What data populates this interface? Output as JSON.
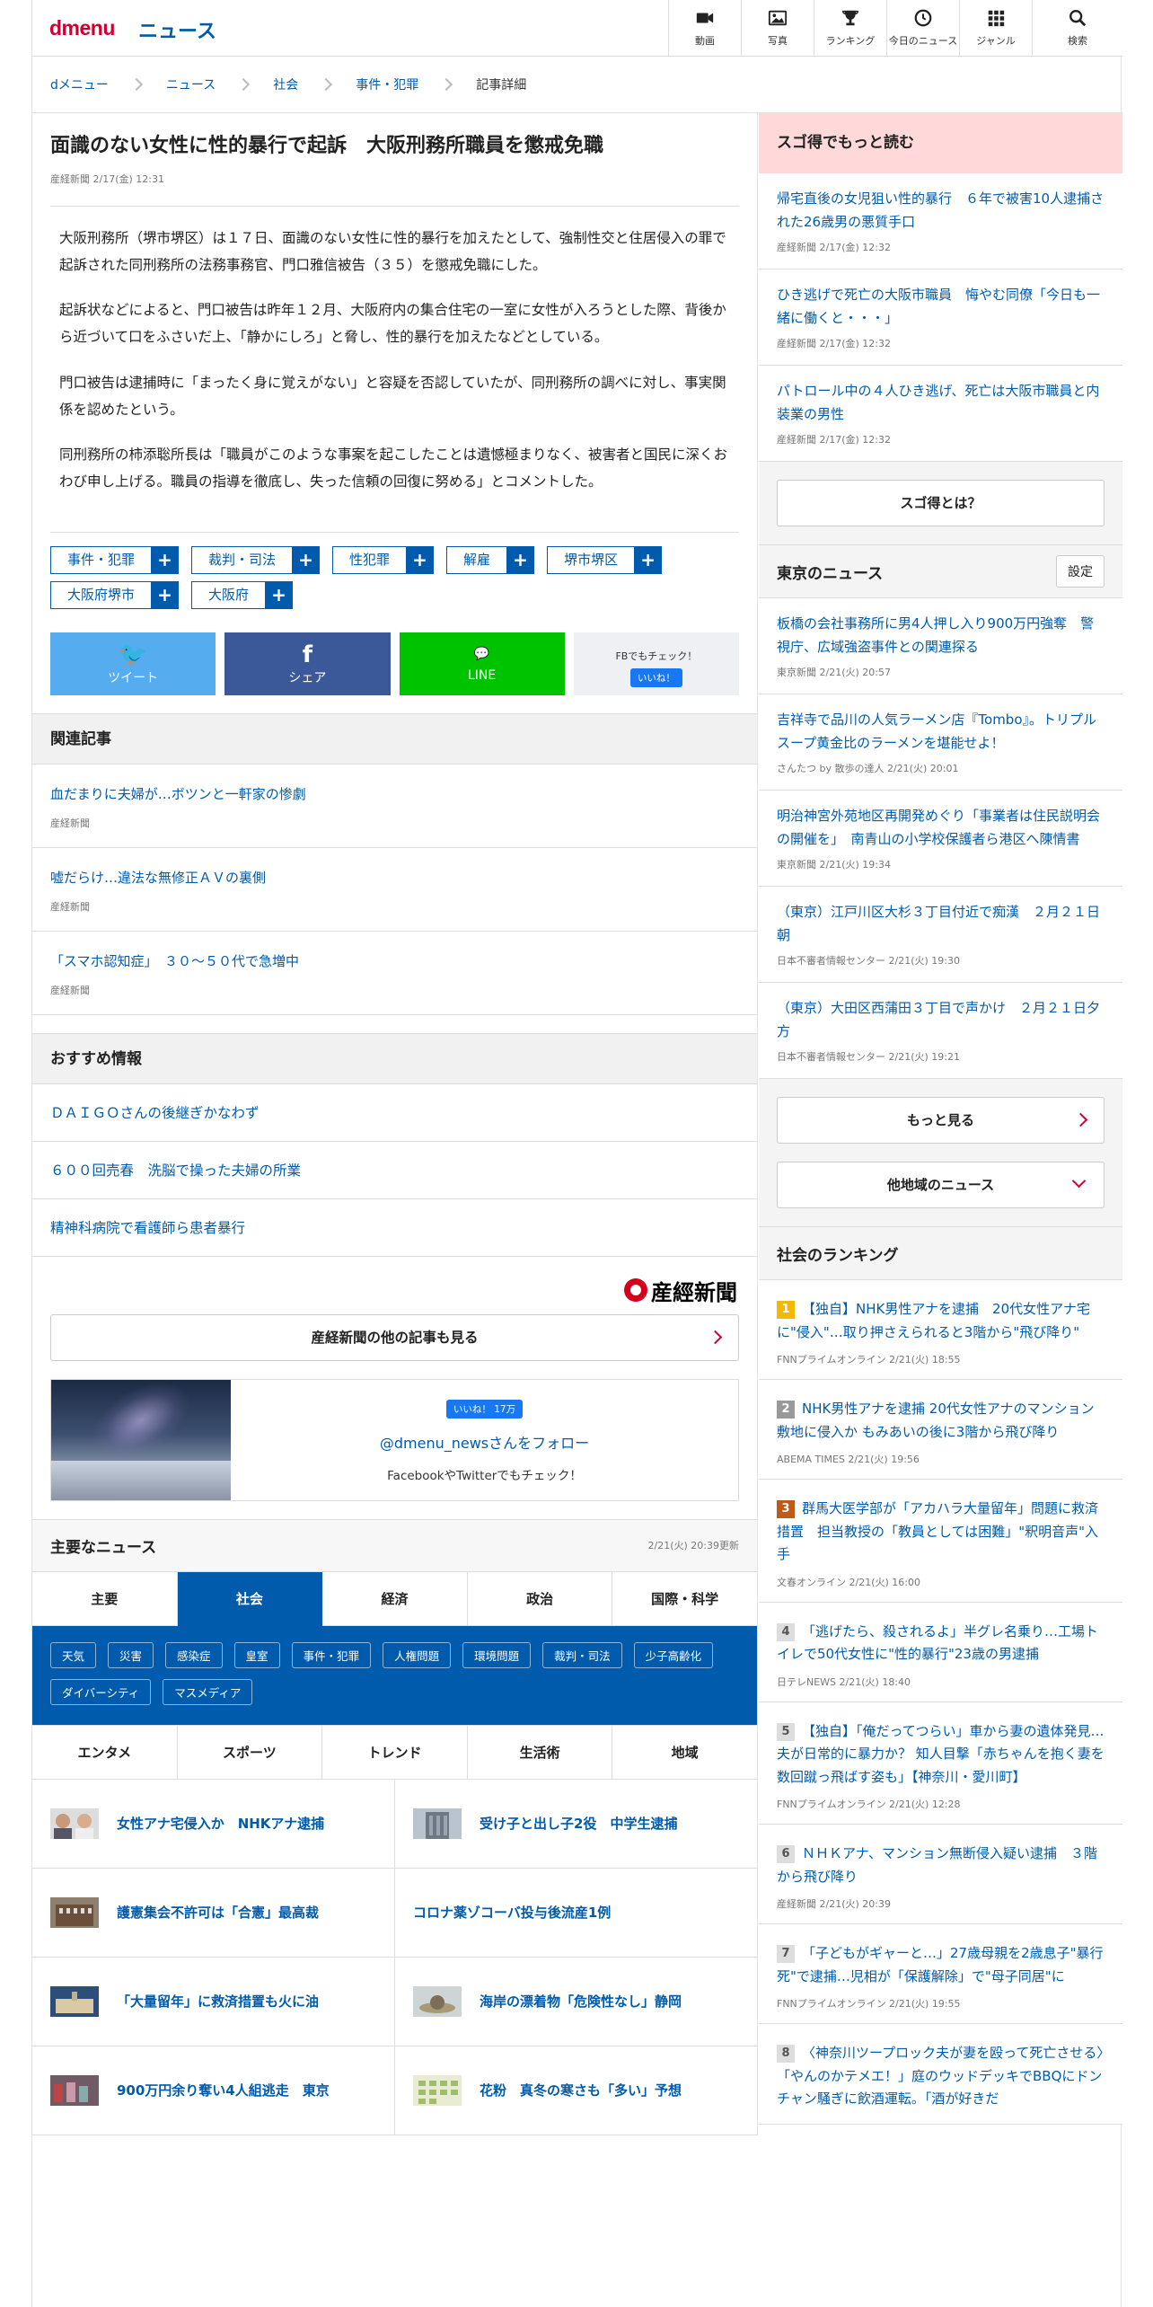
{
  "header": {
    "logo": "dmenu",
    "section": "ニュース",
    "nav": [
      {
        "label": "動画",
        "icon": "video-icon"
      },
      {
        "label": "写真",
        "icon": "photo-icon"
      },
      {
        "label": "ランキング",
        "icon": "trophy-icon"
      },
      {
        "label": "今日のニュース",
        "icon": "clock-icon"
      },
      {
        "label": "ジャンル",
        "icon": "grid-icon"
      },
      {
        "label": "検索",
        "icon": "search-icon"
      }
    ]
  },
  "breadcrumb": [
    "dメニュー",
    "ニュース",
    "社会",
    "事件・犯罪",
    "記事詳細"
  ],
  "article": {
    "title": "面識のない女性に性的暴行で起訴　大阪刑務所職員を懲戒免職",
    "meta": "産経新聞 2/17(金) 12:31",
    "paragraphs": [
      "大阪刑務所（堺市堺区）は１７日、面識のない女性に性的暴行を加えたとして、強制性交と住居侵入の罪で起訴された同刑務所の法務事務官、門口雅信被告（３５）を懲戒免職にした。",
      "起訴状などによると、門口被告は昨年１２月、大阪府内の集合住宅の一室に女性が入ろうとした際、背後から近づいて口をふさいだ上、「静かにしろ」と脅し、性的暴行を加えたなどとしている。",
      "門口被告は逮捕時に「まったく身に覚えがない」と容疑を否認していたが、同刑務所の調べに対し、事実関係を認めたという。",
      "同刑務所の柿添聡所長は「職員がこのような事案を起こしたことは遺憾極まりなく、被害者と国民に深くおわび申し上げる。職員の指導を徹底し、失った信頼の回復に努める」とコメントした。"
    ],
    "tags": [
      "事件・犯罪",
      "裁判・司法",
      "性犯罪",
      "解雇",
      "堺市堺区",
      "大阪府堺市",
      "大阪府"
    ],
    "share": {
      "tweet": "ツイート",
      "share": "シェア",
      "line": "LINE",
      "fb_check": "FBでもチェック！",
      "fb_like": "いいね！"
    }
  },
  "related": {
    "heading": "関連記事",
    "items": [
      {
        "title": "血だまりに夫婦が…ボツンと一軒家の惨劇",
        "source": "産経新聞"
      },
      {
        "title": "嘘だらけ…違法な無修正ＡＶの裏側",
        "source": "産経新聞"
      },
      {
        "title": "「スマホ認知症」　３０〜５０代で急増中",
        "source": "産経新聞"
      }
    ]
  },
  "recommend": {
    "heading": "おすすめ情報",
    "items": [
      "ＤＡＩＧＯさんの後継ぎかなわず",
      "６００回売春　洗脳で操った夫婦の所業",
      "精神科病院で看護師ら患者暴行"
    ],
    "sankei_logo": "産經新聞",
    "more_label": "産経新聞の他の記事も見る"
  },
  "follow": {
    "like": "いいね！ 17万",
    "name": "@dmenu_newsさんをフォロー",
    "note": "FacebookやTwitterでもチェック！"
  },
  "major": {
    "heading": "主要なニュース",
    "updated": "2/21(火) 20:39更新",
    "tabs": [
      "主要",
      "社会",
      "経済",
      "政治",
      "国際・科学"
    ],
    "subtags": [
      "天気",
      "災害",
      "感染症",
      "皇室",
      "事件・犯罪",
      "人権問題",
      "環境問題",
      "裁判・司法",
      "少子高齢化",
      "ダイバーシティ",
      "マスメディア"
    ],
    "tabs2": [
      "エンタメ",
      "スポーツ",
      "トレンド",
      "生活術",
      "地域"
    ],
    "items": [
      {
        "title": "女性アナ宅侵入か　NHKアナ逮捕",
        "thumb": true
      },
      {
        "title": "受け子と出し子2役　中学生逮捕",
        "thumb": true
      },
      {
        "title": "護憲集会不許可は「合憲」最高裁",
        "thumb": true
      },
      {
        "title": "コロナ薬ゾコーバ投与後流産1例",
        "thumb": false
      },
      {
        "title": "「大量留年」に救済措置も火に油",
        "thumb": true
      },
      {
        "title": "海岸の漂着物「危険性なし」静岡",
        "thumb": true
      },
      {
        "title": "900万円余り奪い4人組逃走　東京",
        "thumb": true
      },
      {
        "title": "花粉　真冬の寒さも「多い」予想",
        "thumb": true
      }
    ]
  },
  "sidebar": {
    "sugotoku": {
      "heading": "スゴ得でもっと読む",
      "items": [
        {
          "title": "帰宅直後の女児狙い性的暴行　６年で被害10人逮捕された26歳男の悪質手口",
          "source": "産経新聞 2/17(金) 12:32"
        },
        {
          "title": "ひき逃げで死亡の大阪市職員　悔やむ同僚「今日も一緒に働くと・・・」",
          "source": "産経新聞 2/17(金) 12:32"
        },
        {
          "title": "パトロール中の４人ひき逃げ、死亡は大阪市職員と内装業の男性",
          "source": "産経新聞 2/17(金) 12:32"
        }
      ],
      "about": "スゴ得とは？"
    },
    "tokyo": {
      "heading": "東京のニュース",
      "setting": "設定",
      "items": [
        {
          "title": "板橋の会社事務所に男4人押し入り900万円強奪　警視庁、広域強盗事件との関連探る",
          "source": "東京新聞 2/21(火) 20:57"
        },
        {
          "title": "吉祥寺で品川の人気ラーメン店『Tombo』。トリプルスープ黄金比のラーメンを堪能せよ！",
          "source": "さんたつ by 散歩の達人 2/21(火) 20:01"
        },
        {
          "title": "明治神宮外苑地区再開発めぐり「事業者は住民説明会の開催を」　南青山の小学校保護者ら港区へ陳情書",
          "source": "東京新聞 2/21(火) 19:34"
        },
        {
          "title": "（東京）江戸川区大杉３丁目付近で痴漢　２月２１日朝",
          "source": "日本不審者情報センター 2/21(火) 19:30"
        },
        {
          "title": "（東京）大田区西蒲田３丁目で声かけ　２月２１日夕方",
          "source": "日本不審者情報センター 2/21(火) 19:21"
        }
      ],
      "more": "もっと見る",
      "other": "他地域のニュース"
    },
    "ranking": {
      "heading": "社会のランキング",
      "items": [
        {
          "rank": "1",
          "title": "【独自】NHK男性アナを逮捕　20代女性アナ宅に\"侵入\"…取り押さえられると3階から\"飛び降り\"",
          "source": "FNNプライムオンライン 2/21(火) 18:55"
        },
        {
          "rank": "2",
          "title": "NHK男性アナを逮捕 20代女性アナのマンション敷地に侵入か もみあいの後に3階から飛び降り",
          "source": "ABEMA TIMES 2/21(火) 19:56"
        },
        {
          "rank": "3",
          "title": "群馬大医学部が「アカハラ大量留年」問題に救済措置　担当教授の「教員としては困難」\"釈明音声\"入手",
          "source": "文春オンライン 2/21(火) 16:00"
        },
        {
          "rank": "4",
          "title": "「逃げたら、殺されるよ」半グレ名乗り…工場トイレで50代女性に\"性的暴行\"23歳の男逮捕",
          "source": "日テレNEWS 2/21(火) 18:40"
        },
        {
          "rank": "5",
          "title": "【独自】「俺だってつらい」車から妻の遺体発見…夫が日常的に暴力か？ 知人目撃「赤ちゃんを抱く妻を数回蹴っ飛ばす姿も」【神奈川・愛川町】",
          "source": "FNNプライムオンライン 2/21(火) 12:28"
        },
        {
          "rank": "6",
          "title": "ＮＨＫアナ、マンション無断侵入疑い逮捕　３階から飛び降り",
          "source": "産経新聞 2/21(火) 20:39"
        },
        {
          "rank": "7",
          "title": "「子どもがギャーと…」27歳母親を2歳息子\"暴行死\"で逮捕…児相が「保護解除」で\"母子同居\"に",
          "source": "FNNプライムオンライン 2/21(火) 19:55"
        },
        {
          "rank": "8",
          "title": "〈神奈川ツープロック夫が妻を殴って死亡させる〉「やんのかテメエ！」庭のウッドデッキでBBQにドンチャン騒ぎに飲酒運転。「酒が好きだ"
        }
      ]
    }
  }
}
